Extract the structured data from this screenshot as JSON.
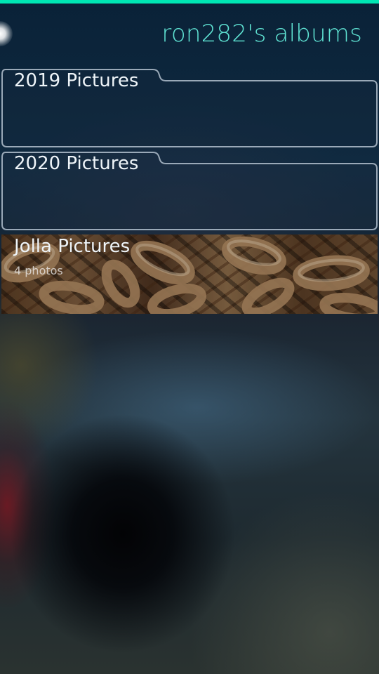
{
  "colors": {
    "accent": "#00e6b4",
    "title": "#5fe3d3",
    "text_primary": "#eef4f8",
    "frame_stroke": "#9aa9b8"
  },
  "header": {
    "title": "ron282's albums",
    "pulley_icon": "pulley-menu-indicator"
  },
  "albums": [
    {
      "name": "2019 Pictures",
      "count": ""
    },
    {
      "name": "2020 Pictures",
      "count": ""
    },
    {
      "name": "Jolla Pictures",
      "count": "4 photos",
      "cover": "rusty-chain-links"
    }
  ]
}
